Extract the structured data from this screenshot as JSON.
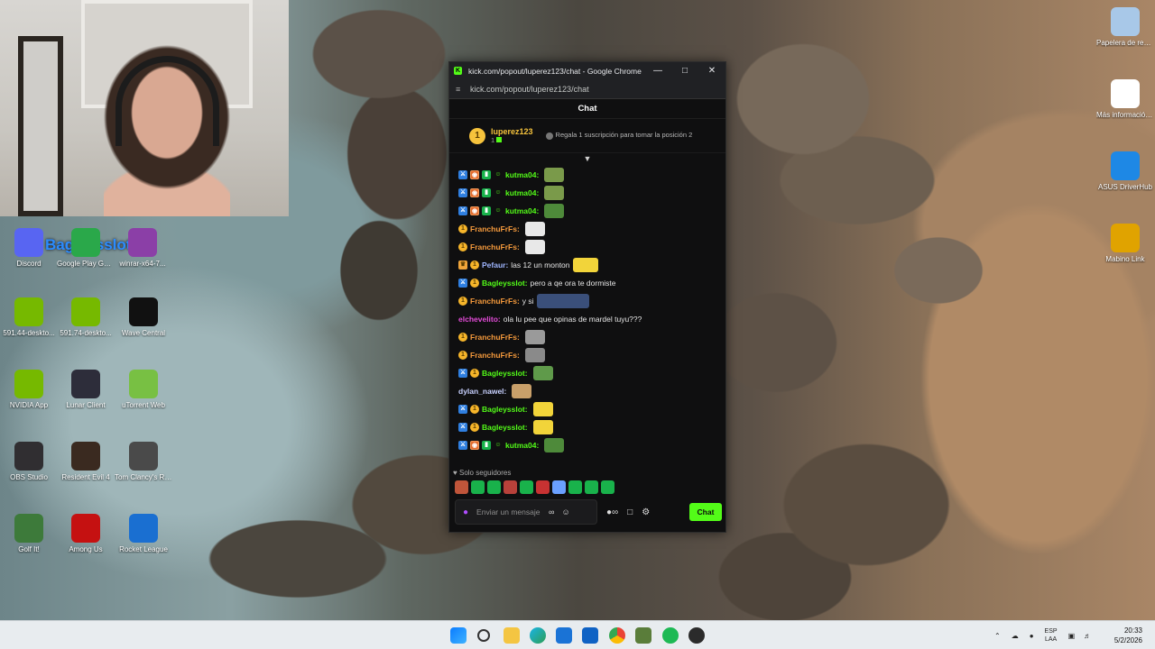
{
  "overlay": {
    "text": "Bagleysslot"
  },
  "desktop_icons_left": [
    {
      "label": "Discord",
      "icon": "discord-icon",
      "color": "#5865f2"
    },
    {
      "label": "Google Play Games",
      "icon": "google-play-games-icon",
      "color": "#2aa84a"
    },
    {
      "label": "winrar-x64-7...",
      "icon": "winrar-icon",
      "color": "#8b3fa7"
    },
    {
      "label": "591.44-deskto...",
      "icon": "nvidia-installer-icon",
      "color": "#76b900"
    },
    {
      "label": "591.74-deskto...",
      "icon": "nvidia-installer-icon",
      "color": "#76b900"
    },
    {
      "label": "Wave Central",
      "icon": "wave-central-icon",
      "color": "#111111"
    },
    {
      "label": "NVIDIA App",
      "icon": "nvidia-app-icon",
      "color": "#76b900"
    },
    {
      "label": "Lunar Client",
      "icon": "lunar-client-icon",
      "color": "#2d2d3a"
    },
    {
      "label": "uTorrent Web",
      "icon": "utorrent-icon",
      "color": "#78c043"
    },
    {
      "label": "OBS Studio",
      "icon": "obs-icon",
      "color": "#302e31"
    },
    {
      "label": "Resident Evil 4",
      "icon": "resident-evil-icon",
      "color": "#3a2a20"
    },
    {
      "label": "Tom Clancy's Rainbow Six...",
      "icon": "rainbow-six-icon",
      "color": "#4a4a4a"
    },
    {
      "label": "Golf It!",
      "icon": "golf-it-icon",
      "color": "#3d7a3a"
    },
    {
      "label": "Among Us",
      "icon": "among-us-icon",
      "color": "#c51111"
    },
    {
      "label": "Rocket League",
      "icon": "rocket-league-icon",
      "color": "#1a6fd1"
    }
  ],
  "desktop_icons_right": [
    {
      "label": "Papelera de reciclaje",
      "icon": "recycle-bin-icon",
      "color": "#a8c8e8"
    },
    {
      "label": "Más información sobre esta ima...",
      "icon": "spotlight-info-icon",
      "color": "#ffffff"
    },
    {
      "label": "ASUS DriverHub",
      "icon": "asus-driverhub-icon",
      "color": "#1e88e5"
    },
    {
      "label": "Mabino Link",
      "icon": "mabino-link-icon",
      "color": "#e0a300"
    }
  ],
  "window": {
    "title": "kick.com/popout/luperez123/chat - Google Chrome",
    "url": "kick.com/popout/luperez123/chat",
    "chat_header": "Chat",
    "pinned": {
      "user": "luperez123",
      "count": "1",
      "rank": "1",
      "gift_text": "Regala 1 suscripción para tomar la posición 2"
    },
    "followers_only": "Solo seguidores",
    "input_placeholder": "Enviar un mensaje",
    "send_label": "Chat",
    "accent": "#53fc18"
  },
  "messages": [
    {
      "badges": [
        "mod",
        "og",
        "sub",
        "bot"
      ],
      "user": "kutma04",
      "color": "#53fc18",
      "text": "",
      "emotes": [
        "#7a9a4a"
      ]
    },
    {
      "badges": [
        "mod",
        "og",
        "sub",
        "bot"
      ],
      "user": "kutma04",
      "color": "#53fc18",
      "text": "",
      "emotes": [
        "#7a9a4a"
      ]
    },
    {
      "badges": [
        "mod",
        "og",
        "sub",
        "bot"
      ],
      "user": "kutma04",
      "color": "#53fc18",
      "text": "",
      "emotes": [
        "#4e8a3a"
      ]
    },
    {
      "badges": [
        "coin"
      ],
      "user": "FranchuFrFs",
      "color": "#f59a3c",
      "text": "",
      "emotes": [
        "#e8e8e8"
      ]
    },
    {
      "badges": [
        "coin"
      ],
      "user": "FranchuFrFs",
      "color": "#f59a3c",
      "text": "",
      "emotes": [
        "#e8e8e8"
      ]
    },
    {
      "badges": [
        "crown",
        "coin"
      ],
      "user": "Pefaur",
      "color": "#9fb6ff",
      "text": "las 12 un monton",
      "emotes": [
        "#f2d43a"
      ]
    },
    {
      "badges": [
        "mod",
        "coin"
      ],
      "user": "Bagleysslot",
      "color": "#53fc18",
      "text": "pero a qe ora te dormiste",
      "emotes": []
    },
    {
      "badges": [
        "coin"
      ],
      "user": "FranchuFrFs",
      "color": "#f59a3c",
      "text": "y si",
      "emotes": [
        "#3a4f7a"
      ]
    },
    {
      "badges": [],
      "user": "elchevelito",
      "color": "#e34bd8",
      "text": "ola lu pee que opinas de mardel tuyu???",
      "emotes": []
    },
    {
      "badges": [
        "coin"
      ],
      "user": "FranchuFrFs",
      "color": "#f59a3c",
      "text": "",
      "emotes": [
        "#9a9a9a"
      ]
    },
    {
      "badges": [
        "coin"
      ],
      "user": "FranchuFrFs",
      "color": "#f59a3c",
      "text": "",
      "emotes": [
        "#8a8a8a"
      ]
    },
    {
      "badges": [
        "mod",
        "coin"
      ],
      "user": "Bagleysslot",
      "color": "#53fc18",
      "text": "",
      "emotes": [
        "#5f9a4a"
      ]
    },
    {
      "badges": [],
      "user": "dylan_nawel",
      "color": "#c8d1ff",
      "text": "",
      "emotes": [
        "#c9a06a"
      ]
    },
    {
      "badges": [
        "mod",
        "coin"
      ],
      "user": "Bagleysslot",
      "color": "#53fc18",
      "text": "",
      "emotes": [
        "#f2d43a"
      ]
    },
    {
      "badges": [
        "mod",
        "coin"
      ],
      "user": "Bagleysslot",
      "color": "#53fc18",
      "text": "",
      "emotes": [
        "#f2d43a"
      ]
    },
    {
      "badges": [
        "mod",
        "og",
        "sub",
        "bot"
      ],
      "user": "kutma04",
      "color": "#53fc18",
      "text": "",
      "emotes": [
        "#4e8a3a"
      ]
    }
  ],
  "emote_bar": [
    "#c0553a",
    "#19b24b",
    "#19b24b",
    "#b8413a",
    "#19b24b",
    "#c83232",
    "#6aa0ff",
    "#19b24b",
    "#19b24b",
    "#19b24b"
  ],
  "taskbar": {
    "lang_top": "ESP",
    "lang_bottom": "LAA",
    "time": "20:33",
    "date": "5/2/2026"
  }
}
